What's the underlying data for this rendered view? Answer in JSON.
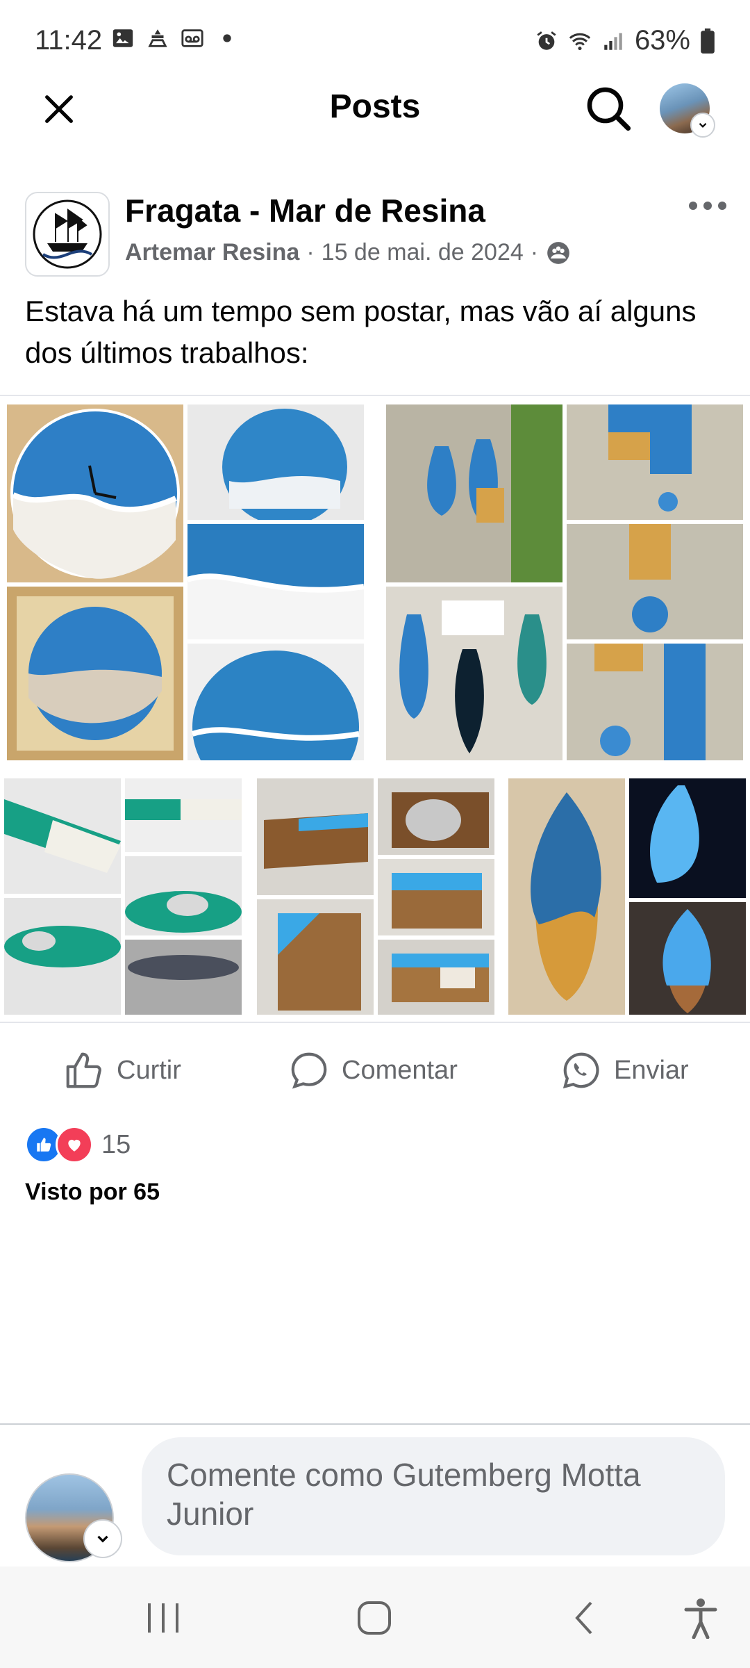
{
  "status_bar": {
    "time": "11:42",
    "battery": "63%",
    "left_icons": [
      "gallery-icon",
      "weather-icon",
      "voicemail-icon",
      "dot-icon"
    ],
    "right_icons": [
      "alarm-icon",
      "wifi-icon",
      "signal-icon",
      "battery-icon"
    ]
  },
  "header": {
    "title": "Posts",
    "icons": [
      "close-icon",
      "search-icon",
      "profile-avatar"
    ]
  },
  "post": {
    "page_name": "Fragata - Mar de Resina",
    "author": "Artemar Resina",
    "separator": "·",
    "date": "15 de mai. de 2024",
    "privacy_icon": "group-icon",
    "text": "Estava há um tempo sem postar, mas vão aí alguns dos últimos trabalhos:",
    "reaction_count": "15",
    "seen": "Visto por 65"
  },
  "actions": {
    "like": "Curtir",
    "comment": "Comentar",
    "send": "Enviar"
  },
  "comment_bar": {
    "placeholder": "Comente como Gutemberg Motta Junior"
  },
  "colors": {
    "brand_blue": "#1877f2",
    "love_red": "#f33e58",
    "secondary_text": "#65676b",
    "comment_bg": "#f0f2f5"
  }
}
